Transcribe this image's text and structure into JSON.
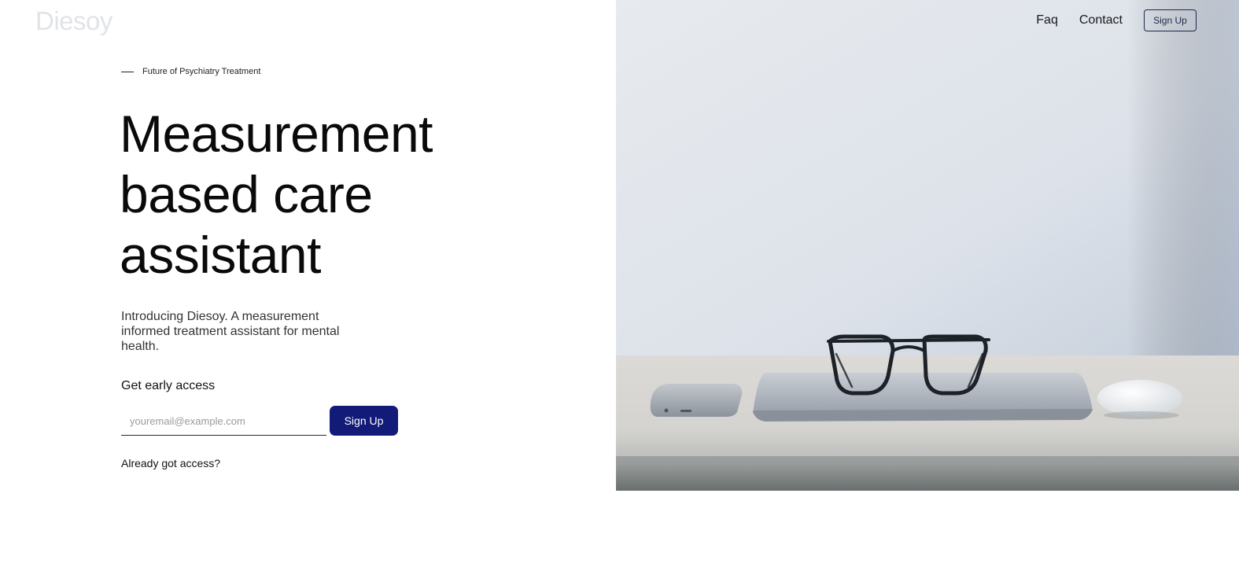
{
  "brand": {
    "name": "Diesoy"
  },
  "nav": {
    "links": [
      {
        "label": "Faq"
      },
      {
        "label": "Contact"
      }
    ],
    "signup_label": "Sign Up"
  },
  "hero": {
    "eyebrow": "Future of Psychiatry Treatment",
    "headline_lines": [
      "Measurement",
      "based care",
      "assistant"
    ],
    "intro": "Introducing Diesoy. A measurement informed treatment assistant for mental health.",
    "early_access_label": "Get early access",
    "email_placeholder": "youremail@example.com",
    "email_value": "",
    "signup_label": "Sign Up",
    "already_label": "Already got access?",
    "image_icon": "desk-photo"
  },
  "colors": {
    "primary_button": "#121c78",
    "nav_border": "#1c2a4a",
    "logo": "#e1e3e6"
  }
}
